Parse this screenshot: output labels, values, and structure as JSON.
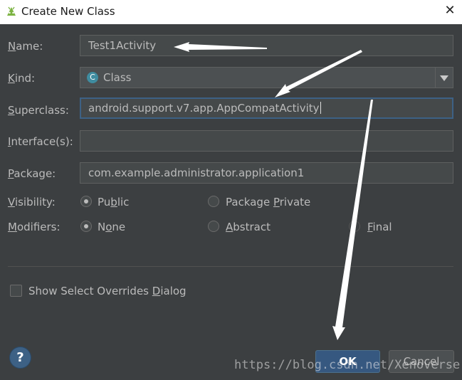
{
  "window": {
    "title": "Create New Class",
    "close_glyph": "✕",
    "app_icon": "android-icon"
  },
  "form": {
    "name_label_mnemonic": "N",
    "name_label_rest": "ame:",
    "name_value": "Test1Activity",
    "kind_label_mnemonic": "K",
    "kind_label_rest": "ind:",
    "kind_value": "Class",
    "kind_icon_letter": "C",
    "kind_icon_color": "#3f8ca0",
    "superclass_label_mnemonic": "S",
    "superclass_label_rest": "uperclass:",
    "superclass_value": "android.support.v7.app.AppCompatActivity",
    "interfaces_label_mnemonic": "I",
    "interfaces_label_rest": "nterface(s):",
    "interfaces_value": "",
    "package_label_mnemonic": "P",
    "package_label_rest": "ackage:",
    "package_value": "com.example.administrator.application1",
    "visibility_label_mnemonic": "V",
    "visibility_label_rest": "isibility:",
    "visibility_public_a": "Pu",
    "visibility_public_m": "b",
    "visibility_public_b": "lic",
    "visibility_package_a": "Package ",
    "visibility_package_m": "P",
    "visibility_package_b": "rivate",
    "modifiers_label_mnemonic": "M",
    "modifiers_label_rest": "odifiers:",
    "modifier_none_a": "N",
    "modifier_none_m": "o",
    "modifier_none_b": "ne",
    "modifier_abstract_m": "A",
    "modifier_abstract_b": "bstract",
    "modifier_final_m": "F",
    "modifier_final_b": "inal"
  },
  "options": {
    "show_overrides_a": "Show Select Overrides ",
    "show_overrides_m": "D",
    "show_overrides_b": "ialog",
    "show_overrides_checked": false
  },
  "footer": {
    "help_glyph": "?",
    "ok_label": "OK",
    "cancel_label": "Cancel"
  },
  "watermark": "https://blog.csdn.net/Xenoverse",
  "colors": {
    "accent": "#365880",
    "focus_border": "#3d6185",
    "background": "#3c3f41"
  }
}
